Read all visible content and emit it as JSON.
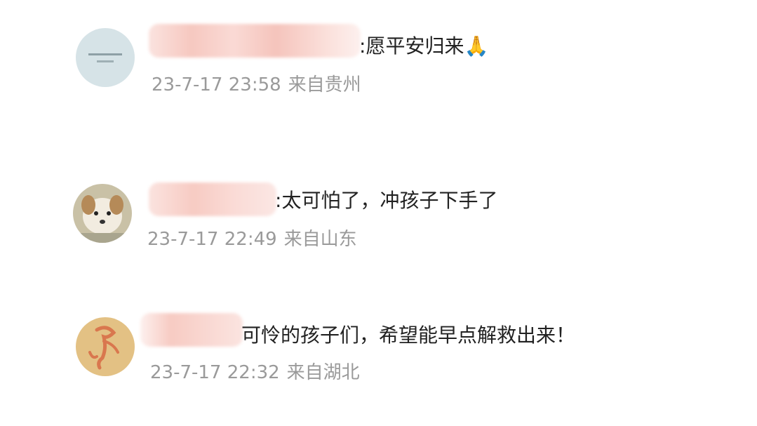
{
  "comments": [
    {
      "separator": ":",
      "text": "愿平安归来",
      "emoji": "🙏",
      "date": "23-7-17 23:58",
      "location": "来自贵州",
      "avatar_icon": "text-avatar-icon"
    },
    {
      "separator": ":",
      "text": "太可怕了，冲孩子下手了",
      "emoji": "",
      "date": "23-7-17 22:49",
      "location": "来自山东",
      "avatar_icon": "dog-avatar-icon"
    },
    {
      "separator": "",
      "text": "可怜的孩子们，希望能早点解救出来！",
      "emoji": "",
      "date": "23-7-17 22:32",
      "location": "来自湖北",
      "avatar_icon": "cartoon-avatar-icon"
    }
  ],
  "colors": {
    "comment_text": "#222222",
    "meta_text": "#9a9a9a",
    "blur_pink": "#f7c9c2"
  }
}
